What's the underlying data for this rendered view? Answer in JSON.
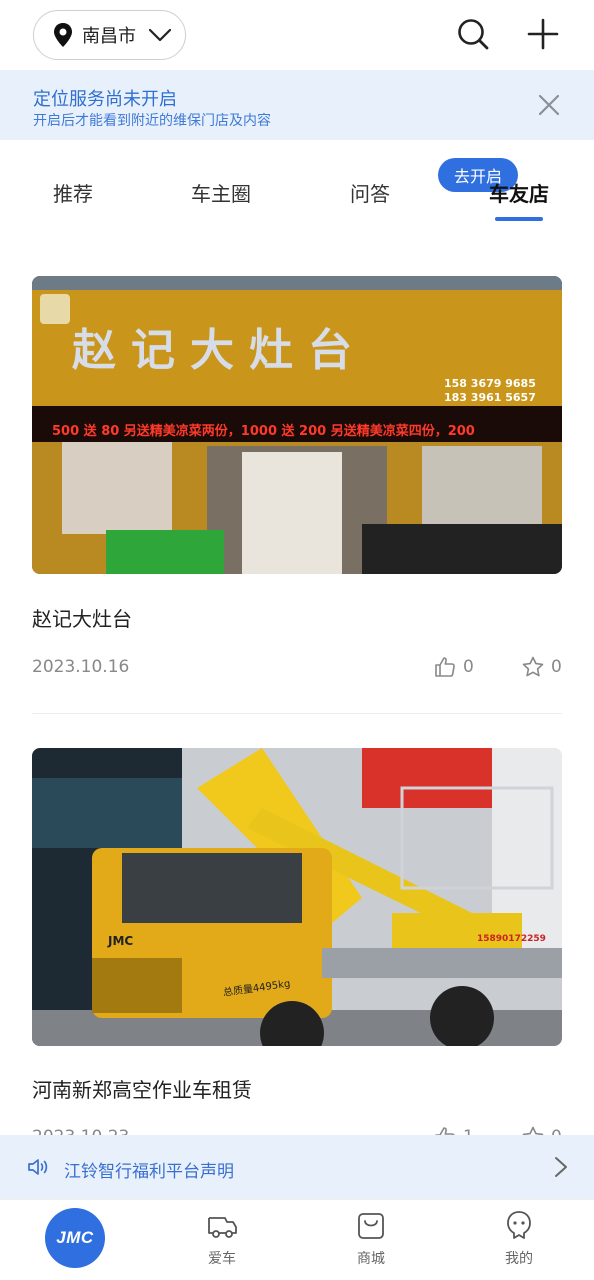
{
  "header": {
    "city": "南昌市",
    "icons": {
      "location": "map-pin-icon",
      "dropdown": "chevron-down-icon",
      "search": "search-icon",
      "add": "plus-icon"
    }
  },
  "location_banner": {
    "title": "定位服务尚未开启",
    "subtitle": "开启后才能看到附近的维保门店及内容",
    "button_label": "去开启"
  },
  "tabs": [
    {
      "label": "推荐",
      "active": false
    },
    {
      "label": "车主圈",
      "active": false
    },
    {
      "label": "问答",
      "active": false
    },
    {
      "label": "车友店",
      "active": true
    }
  ],
  "posts": [
    {
      "title": "赵记大灶台",
      "date": "2023.10.16",
      "likes": "0",
      "favorites": "0",
      "image": {
        "sign_text": "赵 记 大 灶 台",
        "phone_1": "158 3679 9685",
        "phone_2": "183 3961 5657",
        "led_text": "500 送 80 另送精美凉菜两份，1000 送 200 另送精美凉菜四份，200"
      }
    },
    {
      "title": "河南新郑高空作业车租赁",
      "date": "2023.10.23",
      "likes": "1",
      "favorites": "0",
      "image": {
        "truck_brand": "JMC",
        "phone": "15890172259",
        "weight": "总质量4495kg"
      }
    }
  ],
  "notice": {
    "text": "江铃智行福利平台声明"
  },
  "bottom_nav": {
    "logo": "JMC",
    "items": [
      {
        "label": "爱车",
        "icon": "car-icon"
      },
      {
        "label": "商城",
        "icon": "shopping-bag-icon"
      },
      {
        "label": "我的",
        "icon": "profile-icon"
      }
    ]
  },
  "colors": {
    "accent": "#2f6fe0",
    "banner_bg": "#e8f1fb",
    "muted_text": "#888888"
  }
}
